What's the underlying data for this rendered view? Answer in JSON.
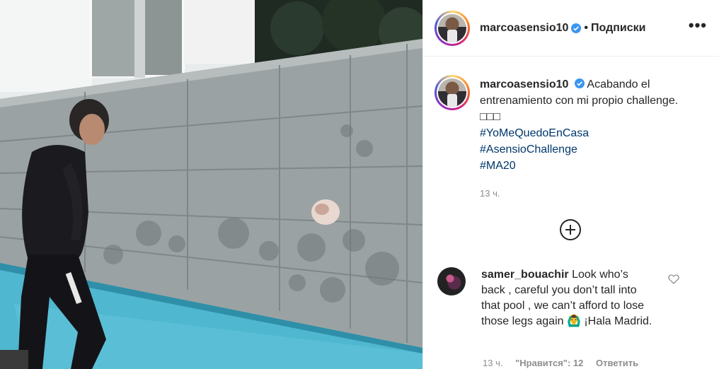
{
  "post": {
    "username": "marcoasensio10",
    "separator": "•",
    "follow_label": "Подписки",
    "more_label": "•••",
    "caption_text": "Acabando el entrenamiento con mi propio challenge. □□□",
    "hashtags": [
      "#YoMeQuedoEnCasa",
      "#AsensioChallenge",
      "#MA20"
    ],
    "time_ago": "13 ч."
  },
  "comment": {
    "username": "samer_bouachir",
    "text": "Look who’s back , careful you don’t tall into that pool , we can’t afford to lose those legs again 🙆‍♂️ ¡Hala Madrid.",
    "time_ago": "13 ч.",
    "likes_label": "\"Нравится\": 12",
    "reply_label": "Ответить"
  },
  "colors": {
    "hashtag": "#00376b",
    "verified": "#3897f0",
    "muted": "#8e8e8e"
  },
  "icons": {
    "verified": "verified-badge-icon",
    "load_more": "plus-circle-icon",
    "like": "heart-icon",
    "more": "ellipsis-icon"
  }
}
